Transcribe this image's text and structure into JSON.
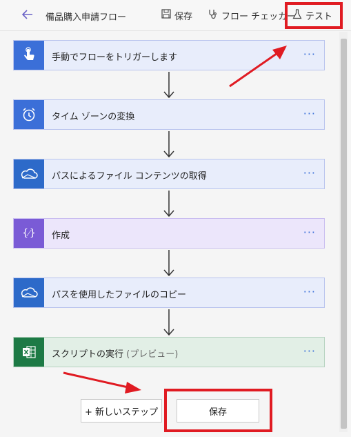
{
  "header": {
    "title": "備品購入申請フロー",
    "save_label": "保存",
    "checker_label": "フロー チェッカー",
    "test_label": "テスト"
  },
  "steps": [
    {
      "label": "手動でフローをトリガーします",
      "icon": "touch-trigger-icon",
      "color": "#3b6fd8"
    },
    {
      "label": "タイム ゾーンの変換",
      "icon": "alarm-clock-icon",
      "color": "#3b6fd8"
    },
    {
      "label": "パスによるファイル コンテンツの取得",
      "icon": "onedrive-cloud-icon",
      "color": "#2d6ac9"
    },
    {
      "label": "作成",
      "icon": "compose-icon",
      "color": "#7a5bd6"
    },
    {
      "label": "パスを使用したファイルのコピー",
      "icon": "onedrive-cloud-icon",
      "color": "#2d6ac9"
    },
    {
      "label": "スクリプトの実行",
      "label_suffix": "(プレビュー)",
      "icon": "excel-icon",
      "color": "#1d7a45"
    }
  ],
  "more_label": "···",
  "footer": {
    "new_step_label": "+ 新しいステップ",
    "save_label": "保存"
  },
  "annotation_color": "#e01b22"
}
